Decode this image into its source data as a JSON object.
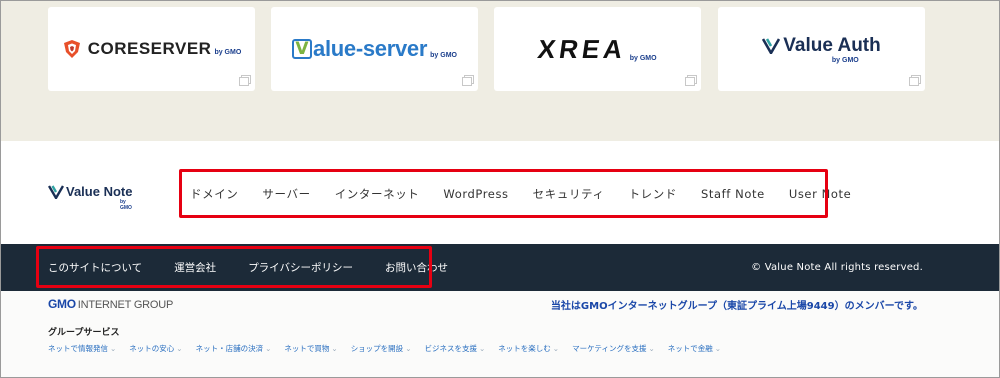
{
  "partner_logos": [
    {
      "name": "CORESERVER",
      "by": "by GMO"
    },
    {
      "name": "alue-server",
      "mark": "V",
      "by": "by GMO"
    },
    {
      "name": "XREA",
      "by": "by GMO"
    },
    {
      "name": "Value Auth",
      "by": "by GMO"
    }
  ],
  "site_logo": {
    "text": "Value Note",
    "by": "by GMO"
  },
  "main_nav": [
    {
      "label": "ドメイン"
    },
    {
      "label": "サーバー"
    },
    {
      "label": "インターネット"
    },
    {
      "label": "WordPress"
    },
    {
      "label": "セキュリティ"
    },
    {
      "label": "トレンド"
    },
    {
      "label": "Staff Note"
    },
    {
      "label": "User Note"
    }
  ],
  "footer_nav": [
    {
      "label": "このサイトについて"
    },
    {
      "label": "運営会社"
    },
    {
      "label": "プライバシーポリシー"
    },
    {
      "label": "お問い合わせ"
    }
  ],
  "copyright": "© Value Note All rights reserved.",
  "gmo_logo": {
    "mark": "GMO",
    "text": "INTERNET GROUP"
  },
  "member_text": "当社はGMOインターネットグループ（東証プライム上場9449）のメンバーです。",
  "group_services": {
    "title": "グループサービス",
    "links": [
      {
        "label": "ネットで情報発信"
      },
      {
        "label": "ネットの安心"
      },
      {
        "label": "ネット・店舗の決済"
      },
      {
        "label": "ネットで買物"
      },
      {
        "label": "ショップを開設"
      },
      {
        "label": "ビジネスを支援"
      },
      {
        "label": "ネットを楽しむ"
      },
      {
        "label": "マーケティングを支援"
      },
      {
        "label": "ネットで金融"
      }
    ]
  },
  "colors": {
    "beige": "#efede3",
    "dark_bar": "#1c2a38",
    "highlight_red": "#e60012",
    "link_blue": "#2a6fc0",
    "gmo_blue": "#1a47a8"
  }
}
